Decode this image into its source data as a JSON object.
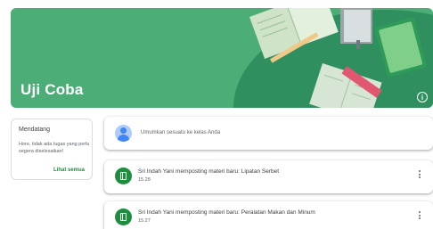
{
  "banner": {
    "title": "Uji Coba",
    "info_icon": "info-icon",
    "color": "#4cad76"
  },
  "upcoming": {
    "title": "Mendatang",
    "text": "Hore, tidak ada tugas yang perlu segera diselesaikan!",
    "link": "Lihat semua"
  },
  "announcement": {
    "placeholder": "Umumkan sesuatu ke kelas Anda"
  },
  "posts": [
    {
      "title": "Sri Indah Yani memposting materi baru: Lipatan Serbet",
      "time": "15.28",
      "icon": "material-icon"
    },
    {
      "title": "Sri Indah Yani memposting materi baru: Peralatan Makan dan Minum",
      "time": "15.27",
      "icon": "material-icon"
    }
  ],
  "colors": {
    "accent": "#1e8e3e",
    "banner": "#4cad76"
  }
}
